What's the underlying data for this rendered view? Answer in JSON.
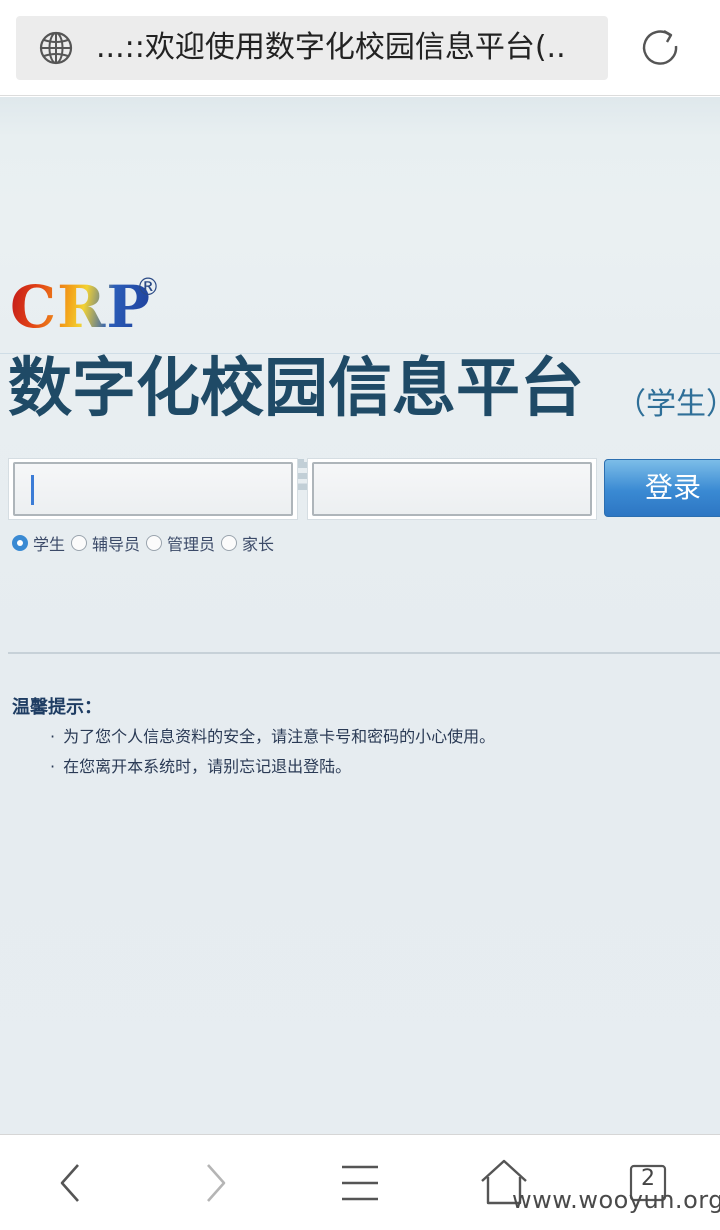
{
  "browser": {
    "url_title": "...::欢迎使用数字化校园信息平台(.."
  },
  "brand": {
    "logo": "CRP",
    "reg_mark": "®",
    "title": "数字化校园信息平台",
    "subtitle": "（学生）"
  },
  "login": {
    "username_value": "",
    "password_value": "",
    "button_label": "登录",
    "roles": [
      {
        "label": "学生",
        "selected": true
      },
      {
        "label": "辅导员",
        "selected": false
      },
      {
        "label": "管理员",
        "selected": false
      },
      {
        "label": "家长",
        "selected": false
      }
    ]
  },
  "tips": {
    "title": "温馨提示：",
    "items": [
      "为了您个人信息资料的安全，请注意卡号和密码的小心使用。",
      "在您离开本系统时，请别忘记退出登陆。"
    ]
  },
  "nav": {
    "tab_count": "2"
  },
  "watermark": "www.wooyun.org",
  "icons": {
    "address": "globe-icon",
    "reload": "reload-icon",
    "back": "chevron-left-icon",
    "forward": "chevron-right-icon",
    "menu": "menu-icon",
    "home": "home-icon",
    "tabs": "tabs-icon"
  }
}
